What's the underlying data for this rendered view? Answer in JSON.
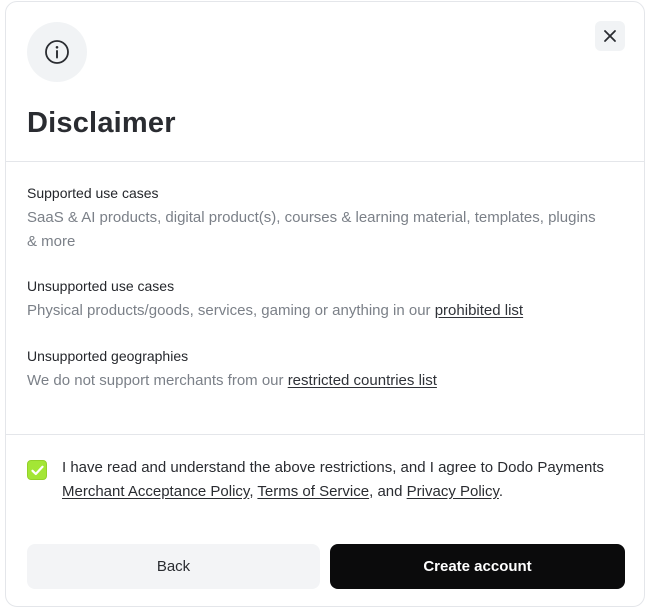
{
  "dialog": {
    "title": "Disclaimer"
  },
  "sections": [
    {
      "title": "Supported use cases",
      "body": "SaaS & AI products, digital product(s), courses & learning material, templates, plugins & more"
    },
    {
      "title": "Unsupported use cases",
      "body_prefix": "Physical products/goods, services, gaming or anything in our ",
      "link": "prohibited list"
    },
    {
      "title": "Unsupported geographies",
      "body_prefix": "We do not support merchants from our ",
      "link": "restricted countries list"
    }
  ],
  "agreement": {
    "checked": true,
    "text_prefix": "I have read and understand the above restrictions, and I agree to Dodo Payments ",
    "link1": "Merchant Acceptance Policy",
    "sep1": ", ",
    "link2": "Terms of Service",
    "sep2": ", and ",
    "link3": "Privacy Policy",
    "suffix": "."
  },
  "buttons": {
    "back": "Back",
    "create": "Create account"
  },
  "colors": {
    "checkbox_accent": "#a3e635",
    "primary_button": "#0b0b0c"
  },
  "icons": {
    "header": "info-icon",
    "close": "close-icon",
    "checkbox": "check-icon"
  }
}
